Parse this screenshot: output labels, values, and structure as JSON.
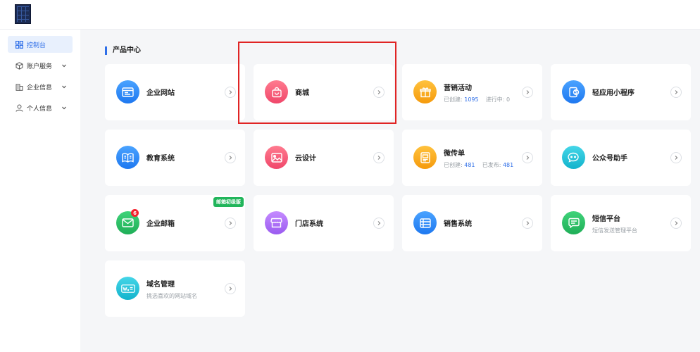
{
  "sidebar": {
    "items": [
      {
        "label": "控制台",
        "active": true
      },
      {
        "label": "账户服务"
      },
      {
        "label": "企业信息"
      },
      {
        "label": "个人信息"
      }
    ]
  },
  "main": {
    "section_title": "产品中心",
    "cards": [
      {
        "name": "企业网站"
      },
      {
        "name": "商城"
      },
      {
        "name": "营销活动",
        "sub": {
          "created_label": "已创建:",
          "created": "1095",
          "other_label": "进行中:",
          "other": "0"
        }
      },
      {
        "name": "轻应用小程序"
      },
      {
        "name": "教育系统"
      },
      {
        "name": "云设计"
      },
      {
        "name": "微传单",
        "sub": {
          "created_label": "已创建:",
          "created": "481",
          "other_label": "已发布:",
          "other": "481"
        }
      },
      {
        "name": "公众号助手"
      },
      {
        "name": "企业邮箱",
        "tag": "邮箱初级版",
        "count": "6"
      },
      {
        "name": "门店系统"
      },
      {
        "name": "销售系统"
      },
      {
        "name": "短信平台",
        "desc": "短信发送管理平台"
      },
      {
        "name": "域名管理",
        "desc": "挑选喜欢的网站域名"
      }
    ]
  },
  "colors": {
    "accent": "#2f6fe8",
    "highlight": "#e02424"
  }
}
